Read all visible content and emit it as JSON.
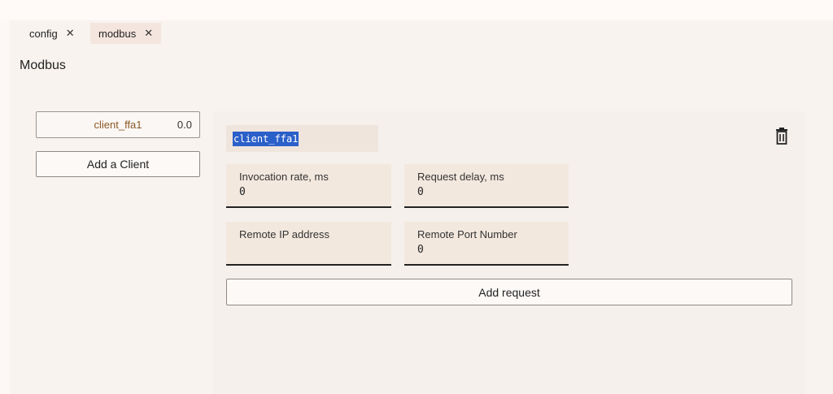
{
  "tabs": [
    {
      "label": "config",
      "close": "✕"
    },
    {
      "label": "modbus",
      "close": "✕"
    }
  ],
  "page": {
    "title": "Modbus"
  },
  "clients": [
    {
      "name": "client_ffa1",
      "value": "0.0"
    }
  ],
  "add_client_label": "Add a Client",
  "detail": {
    "name_value": "client_ffa1",
    "fields": [
      {
        "label": "Invocation rate, ms",
        "value": "0"
      },
      {
        "label": "Request delay, ms",
        "value": "0"
      },
      {
        "label": "Remote IP address",
        "value": ""
      },
      {
        "label": "Remote Port Number",
        "value": "0"
      }
    ],
    "add_request_label": "Add request",
    "delete_icon": "trash-icon"
  },
  "colors": {
    "accent_selection": "#2b5fc9",
    "client_name": "#8a5a26",
    "active_tab": "#f4e6de",
    "field_bg": "#f3e8de"
  }
}
